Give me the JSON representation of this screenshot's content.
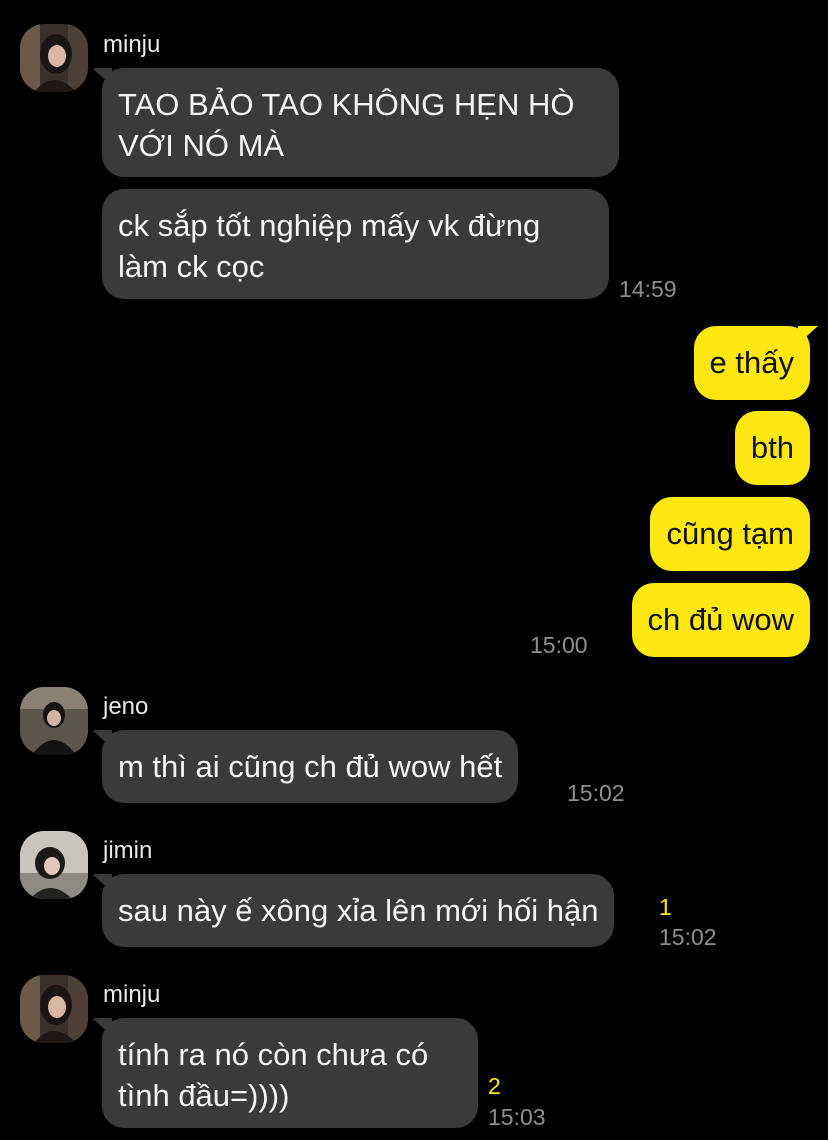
{
  "colors": {
    "background": "#000000",
    "incoming_bubble": "#3a3a3c",
    "outgoing_bubble": "#ffe812",
    "timestamp": "#8e8e93",
    "unread_count": "#ffe812"
  },
  "chat": {
    "groups": [
      {
        "sender": "minju",
        "avatar": "avatar-minju",
        "messages": [
          {
            "line1": "TAO BẢO TAO KHÔNG HẸN HÒ",
            "line2": "VỚI NÓ MÀ"
          },
          {
            "line1": "ck sắp tốt nghiệp mấy vk đừng",
            "line2": "làm ck cọc"
          }
        ],
        "time": "14:59"
      },
      {
        "sender": "me",
        "messages": [
          "e thấy",
          "bth",
          "cũng tạm",
          "ch đủ wow"
        ],
        "time": "15:00"
      },
      {
        "sender": "jeno",
        "avatar": "avatar-jeno",
        "messages": [
          "m thì ai cũng ch đủ wow hết"
        ],
        "time": "15:02"
      },
      {
        "sender": "jimin",
        "avatar": "avatar-jimin",
        "messages": [
          "sau này ế xông xỉa lên mới hối hận"
        ],
        "unread": "1",
        "time": "15:02"
      },
      {
        "sender": "minju",
        "avatar": "avatar-minju",
        "messages": [
          {
            "line1": "tính ra nó còn chưa có",
            "line2": "tình đầu=))))"
          }
        ],
        "unread": "2",
        "time": "15:03"
      }
    ]
  }
}
